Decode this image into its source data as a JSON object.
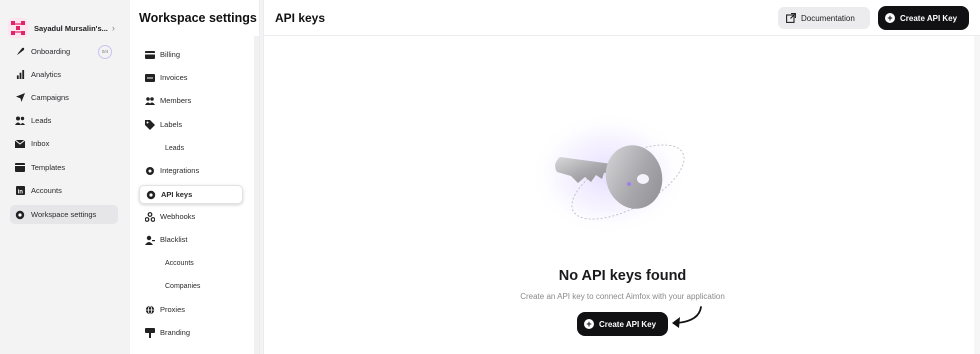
{
  "nav": {
    "workspace_name": "Sayadul Mursalin's...",
    "onboarding_badge": "0/4",
    "items": [
      {
        "label": "Onboarding",
        "icon": "rocket-icon"
      },
      {
        "label": "Analytics",
        "icon": "bar-chart-icon"
      },
      {
        "label": "Campaigns",
        "icon": "send-icon"
      },
      {
        "label": "Leads",
        "icon": "users-icon"
      },
      {
        "label": "Inbox",
        "icon": "inbox-icon"
      },
      {
        "label": "Templates",
        "icon": "template-icon"
      },
      {
        "label": "Accounts",
        "icon": "linkedin-icon"
      },
      {
        "label": "Workspace settings",
        "icon": "gear-icon",
        "active": true
      }
    ]
  },
  "settings": {
    "title": "Workspace settings",
    "items": [
      {
        "label": "Billing",
        "icon": "card-icon"
      },
      {
        "label": "Invoices",
        "icon": "invoice-icon"
      },
      {
        "label": "Members",
        "icon": "members-icon"
      },
      {
        "label": "Labels",
        "icon": "tag-icon"
      },
      {
        "label": "Leads",
        "sub": true
      },
      {
        "label": "Integrations",
        "icon": "plug-icon"
      },
      {
        "label": "API keys",
        "icon": "gear-icon",
        "active": true
      },
      {
        "label": "Webhooks",
        "icon": "webhook-icon"
      },
      {
        "label": "Blacklist",
        "icon": "block-user-icon"
      },
      {
        "label": "Accounts",
        "sub": true
      },
      {
        "label": "Companies",
        "sub": true
      },
      {
        "label": "Proxies",
        "icon": "globe-icon"
      },
      {
        "label": "Branding",
        "icon": "brush-icon"
      }
    ]
  },
  "main": {
    "title": "API keys",
    "documentation_label": "Documentation",
    "create_label": "Create API Key",
    "empty_title": "No API keys found",
    "empty_subtitle": "Create an API key to connect Aimfox with your application",
    "create_center_label": "Create API Key"
  },
  "colors": {
    "accent_dark": "#111113",
    "logo_pink": "#e0246b",
    "glow_purple": "#e9e2ff"
  }
}
